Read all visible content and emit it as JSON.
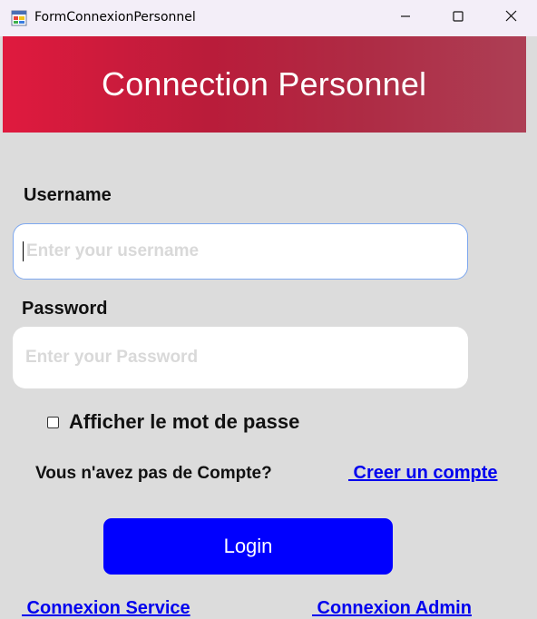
{
  "window": {
    "title": "FormConnexionPersonnel"
  },
  "header": {
    "title": "Connection Personnel",
    "gradient_colors": [
      "#e01a3e",
      "#b91c3a",
      "#ad3f55"
    ]
  },
  "form": {
    "username_label": "Username",
    "username_placeholder": "Enter your username",
    "username_value": "",
    "password_label": "Password",
    "password_placeholder": "Enter your Password",
    "password_value": "",
    "show_password_label": "Afficher le mot de passe",
    "show_password_checked": false,
    "no_account_text": "Vous n'avez pas de Compte?",
    "create_account_link": " Creer un compte",
    "login_button": "Login",
    "login_button_color": "#0000ff"
  },
  "footer": {
    "service_link": " Connexion Service",
    "admin_link": " Connexion Admin"
  },
  "icons": {
    "app": "windows-form-icon",
    "minimize": "minimize-icon",
    "maximize": "maximize-icon",
    "close": "close-icon"
  }
}
